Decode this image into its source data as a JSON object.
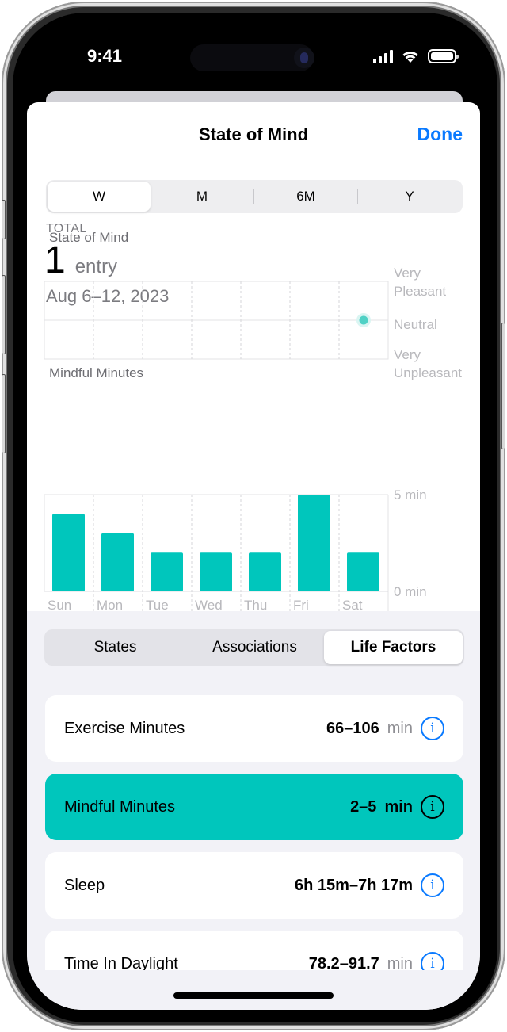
{
  "status_bar": {
    "time": "9:41",
    "signal_icon": "cellular-signal-icon",
    "wifi_icon": "wifi-icon",
    "battery_icon": "battery-icon"
  },
  "header": {
    "title": "State of Mind",
    "done_label": "Done"
  },
  "range_selector": {
    "options": [
      "W",
      "M",
      "6M",
      "Y"
    ],
    "selected": "W"
  },
  "summary": {
    "total_label": "TOTAL",
    "count": "1",
    "unit": "entry",
    "date_range": "Aug 6–12, 2023"
  },
  "chart_data": [
    {
      "type": "scatter",
      "title": "State of Mind",
      "categories": [
        "Sun",
        "Mon",
        "Tue",
        "Wed",
        "Thu",
        "Fri",
        "Sat"
      ],
      "y_labels": [
        "Very Pleasant",
        "Neutral",
        "Very Unpleasant"
      ],
      "ylim": [
        -1,
        1
      ],
      "points": [
        {
          "x": "Sat",
          "y": 0,
          "label": "Neutral"
        }
      ],
      "color": "#4fd1c5",
      "grid": true
    },
    {
      "type": "bar",
      "title": "Mindful Minutes",
      "categories": [
        "Sun",
        "Mon",
        "Tue",
        "Wed",
        "Thu",
        "Fri",
        "Sat"
      ],
      "values": [
        4,
        3,
        2,
        2,
        2,
        5,
        2
      ],
      "ylim": [
        0,
        5
      ],
      "y_ticks": [
        "5 min",
        "0 min"
      ],
      "unit": "min",
      "color": "#00c6bc",
      "grid": true
    }
  ],
  "tabs": {
    "options": [
      "States",
      "Associations",
      "Life Factors"
    ],
    "selected": "Life Factors"
  },
  "life_factors": [
    {
      "name": "Exercise Minutes",
      "value": "66–106",
      "unit": "min",
      "highlighted": false,
      "icon": "info-icon"
    },
    {
      "name": "Mindful Minutes",
      "value": "2–5",
      "unit": "min",
      "highlighted": true,
      "icon": "info-icon"
    },
    {
      "name": "Sleep",
      "value": "6h 15m–7h 17m",
      "unit": "",
      "highlighted": false,
      "icon": "info-icon"
    },
    {
      "name": "Time In Daylight",
      "value": "78.2–91.7",
      "unit": "min",
      "highlighted": false,
      "icon": "info-icon"
    }
  ],
  "colors": {
    "accent": "#0a7aff",
    "teal": "#00c6bc",
    "secondary_text": "#7b7b80"
  }
}
